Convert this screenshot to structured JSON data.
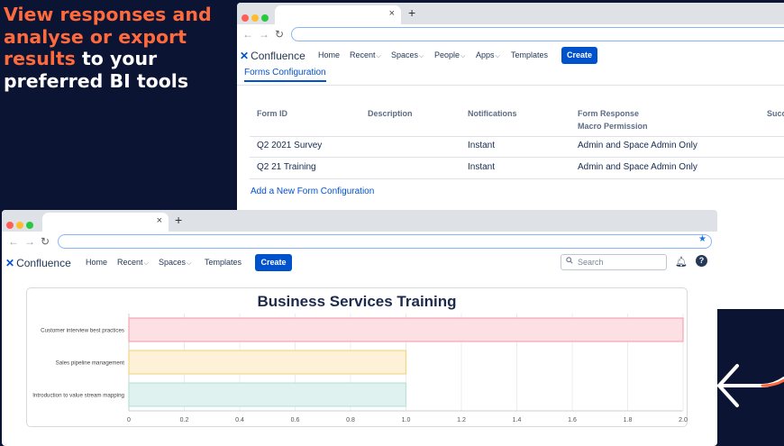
{
  "promo": {
    "line1": "View responses and",
    "line2": "analyse or export",
    "line3_orange": "results",
    "line3_white": " to your",
    "line4": "preferred BI tools"
  },
  "window1": {
    "tab_close": "×",
    "new_tab": "+",
    "logo_text": "Confluence",
    "nav": [
      "Home",
      "Recent",
      "Spaces",
      "People",
      "Apps",
      "Templates"
    ],
    "create_label": "Create",
    "section_tab": "Forms Configuration",
    "table": {
      "headers": [
        "Form ID",
        "Description",
        "Notifications",
        "Form Response",
        "Macro Permission",
        "Succ"
      ],
      "rows": [
        {
          "form_id": "Q2 2021 Survey",
          "description": "",
          "notifications": "Instant",
          "permission": "Admin and Space Admin Only"
        },
        {
          "form_id": "Q2 21 Training",
          "description": "",
          "notifications": "Instant",
          "permission": "Admin and Space Admin Only"
        }
      ]
    },
    "add_link": "Add a New Form Configuration"
  },
  "window2": {
    "tab_close": "×",
    "new_tab": "+",
    "logo_text": "Confluence",
    "nav": [
      "Home",
      "Recent",
      "Spaces",
      "Templates"
    ],
    "create_label": "Create",
    "search_placeholder": "Search"
  },
  "chart_data": {
    "type": "bar",
    "orientation": "horizontal",
    "title": "Business Services Training",
    "categories": [
      "Customer interview best practices",
      "Sales pipeline management",
      "Introduction to value stream mapping"
    ],
    "values": [
      2.0,
      1.0,
      1.0
    ],
    "colors": [
      "#fde0e4",
      "#fdf2d7",
      "#dff2ef"
    ],
    "border_colors": [
      "#f4a5b2",
      "#f3d685",
      "#b8e3d8"
    ],
    "xlim": [
      0,
      2.0
    ],
    "xticks": [
      "0",
      "0.2",
      "0.4",
      "0.6",
      "0.8",
      "1.0",
      "1.2",
      "1.4",
      "1.6",
      "1.8",
      "2.0"
    ],
    "grid": true
  },
  "colors": {
    "background": "#0b1433",
    "accent_orange": "#ff6a3d",
    "confluence_blue": "#0052cc"
  }
}
